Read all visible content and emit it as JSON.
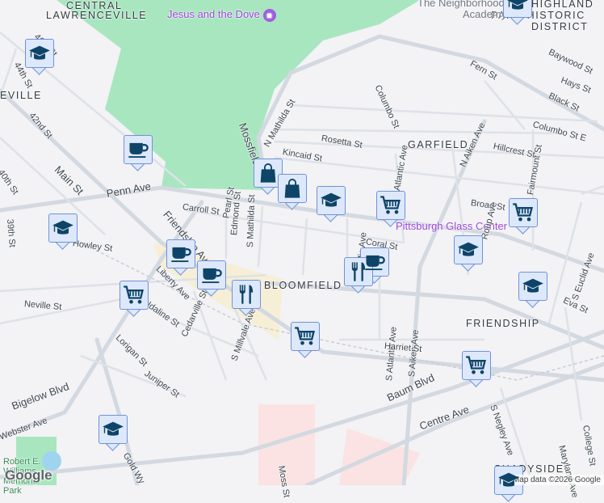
{
  "map": {
    "colors": {
      "background": "#f3f2f4",
      "park": "#a8e6c0",
      "road": "#d3d9e0",
      "marker_fill": "#dde8fb",
      "marker_border": "#6f93d8",
      "icon": "#0e4467",
      "poi": "#9b45d8"
    },
    "neighborhoods": [
      "CENTRAL",
      "LAWRENCEVILLE",
      "EVILLE",
      "GARFIELD",
      "BLOOMFIELD",
      "FRIENDSHIP",
      "HIGHLAND",
      "PARK HISTORIC",
      "DISTRICT",
      "SHADYSIDE"
    ],
    "pois": [
      "Jesus and the Dove",
      "The Neighborhood",
      "Academy",
      "Pittsburgh Glass Center",
      "Robert E. Williams Memorial Park"
    ],
    "streets": [
      "46th St",
      "44th St",
      "42nd St",
      "40th St",
      "39th St",
      "Main St",
      "Penn Ave",
      "Carroll St",
      "Friendship Ave",
      "Pearl St",
      "Edmond St",
      "S Mathilda St",
      "N Mathilda St",
      "Mossfield St",
      "Kincaid St",
      "Rosetta St",
      "Columbo St",
      "Fern St",
      "Black St",
      "Hillcrest St",
      "N Aiken Ave",
      "N Atlantic Ave",
      "Broad St",
      "Fairmount St",
      "Coral St",
      "Liberty Ave",
      "Howley St",
      "Neville St",
      "Idaline St",
      "Cedarville St",
      "Lorigan St",
      "Juniper St",
      "S Millvale Ave",
      "Bigelow Blvd",
      "Webster Ave",
      "Gold Wy",
      "Baum Blvd",
      "Centre Ave",
      "S Pacific Ave",
      "S Atlantic Ave",
      "S Aiken Ave",
      "Harriet St",
      "S Negley Ave",
      "Roup Ave",
      "Eva St",
      "S Euclid Ave",
      "Maryland Ave",
      "College St",
      "Baywood St",
      "Hays St",
      "Moss St",
      "Columbo St E"
    ],
    "markers": [
      "school",
      "coffee",
      "school",
      "shopping-bag",
      "shopping-bag",
      "coffee",
      "school",
      "cart",
      "cart",
      "school",
      "coffee",
      "restaurant",
      "school",
      "coffee",
      "restaurant",
      "cart",
      "cart",
      "cart",
      "school",
      "school",
      "school"
    ],
    "attribution": "Map data ©2026 Google",
    "logo": "Google"
  }
}
